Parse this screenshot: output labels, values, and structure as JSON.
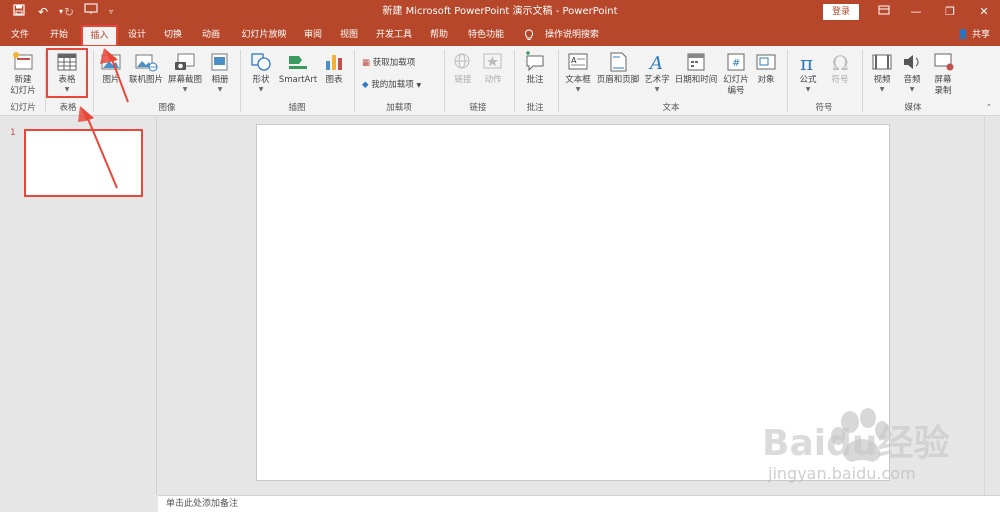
{
  "window": {
    "title": "新建 Microsoft PowerPoint 演示文稿 - PowerPoint",
    "login_label": "登录",
    "share_label": "共享"
  },
  "tabs": [
    {
      "label": "文件"
    },
    {
      "label": "开始"
    },
    {
      "label": "插入"
    },
    {
      "label": "设计"
    },
    {
      "label": "切换"
    },
    {
      "label": "动画"
    },
    {
      "label": "幻灯片放映"
    },
    {
      "label": "审阅"
    },
    {
      "label": "视图"
    },
    {
      "label": "开发工具"
    },
    {
      "label": "帮助"
    },
    {
      "label": "特色功能"
    },
    {
      "label": "操作说明搜索"
    }
  ],
  "ribbon": {
    "slides": {
      "new_slide_line1": "新建",
      "new_slide_line2": "幻灯片",
      "group": "幻灯片"
    },
    "tables": {
      "table": "表格",
      "group": "表格"
    },
    "images": {
      "picture": "图片",
      "online_picture": "联机图片",
      "screenshot": "屏幕截图",
      "album": "相册",
      "group": "图像"
    },
    "illustrations": {
      "shapes": "形状",
      "smartart": "SmartArt",
      "chart": "图表",
      "group": "插图"
    },
    "addins": {
      "get_addins": "获取加载项",
      "my_addins": "我的加载项",
      "group": "加载项"
    },
    "links": {
      "link": "链接",
      "action": "动作",
      "group": "链接"
    },
    "comments": {
      "comment": "批注",
      "group": "批注"
    },
    "text": {
      "textbox": "文本框",
      "header_footer": "页眉和页脚",
      "wordart": "艺术字",
      "datetime": "日期和时间",
      "slide_number_line1": "幻灯片",
      "slide_number_line2": "编号",
      "object": "对象",
      "group": "文本"
    },
    "symbols": {
      "equation": "公式",
      "symbol": "符号",
      "group": "符号"
    },
    "media": {
      "video": "视频",
      "audio": "音频",
      "screen_rec_line1": "屏幕",
      "screen_rec_line2": "录制",
      "group": "媒体"
    }
  },
  "thumbs": {
    "slide_number": "1"
  },
  "notes": {
    "placeholder": "单击此处添加备注"
  },
  "watermark": {
    "brand": "Baidu经验",
    "url": "jingyan.baidu.com"
  },
  "colors": {
    "accent": "#b7472a",
    "highlight": "#e8473a"
  }
}
